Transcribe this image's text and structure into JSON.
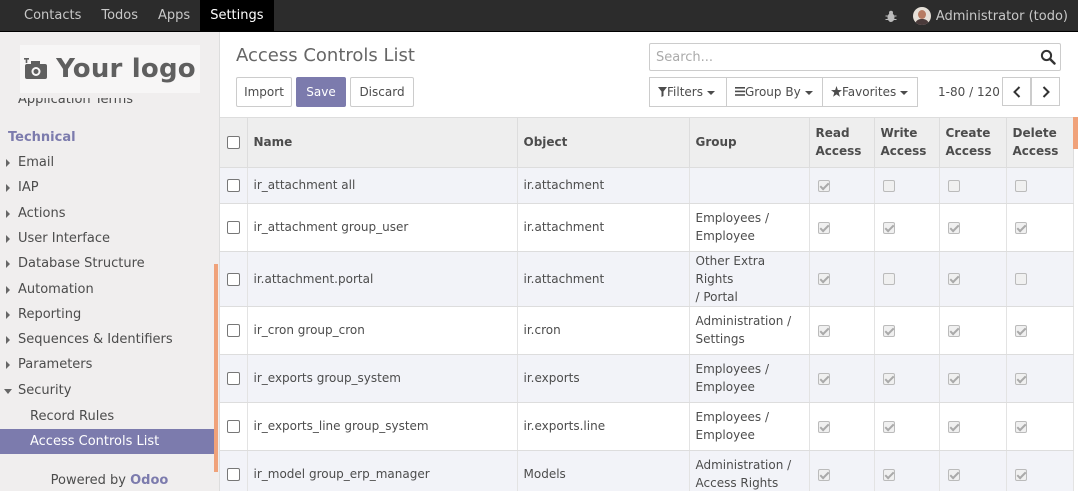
{
  "topbar": {
    "menu": [
      "Contacts",
      "Todos",
      "Apps",
      "Settings"
    ],
    "active_index": 3,
    "user_name": "Administrator (todo)"
  },
  "sidebar": {
    "logo_text": "Your logo",
    "cut_item": "Application Terms",
    "section": "Technical",
    "items": [
      {
        "label": "Email"
      },
      {
        "label": "IAP"
      },
      {
        "label": "Actions"
      },
      {
        "label": "User Interface"
      },
      {
        "label": "Database Structure"
      },
      {
        "label": "Automation"
      },
      {
        "label": "Reporting"
      },
      {
        "label": "Sequences & Identifiers"
      },
      {
        "label": "Parameters"
      },
      {
        "label": "Security"
      },
      {
        "label": "Record Rules"
      },
      {
        "label": "Access Controls List"
      }
    ],
    "powered_by": "Powered by",
    "powered_brand": "Odoo"
  },
  "control_panel": {
    "title": "Access Controls List",
    "import_label": "Import",
    "save_label": "Save",
    "discard_label": "Discard",
    "search_placeholder": "Search...",
    "filters_label": "Filters",
    "group_by_label": "Group By",
    "favorites_label": "Favorites",
    "pager_value": "1-80",
    "pager_sep": "/",
    "pager_total": "120"
  },
  "table": {
    "headers": {
      "name": "Name",
      "object": "Object",
      "group": "Group",
      "read": [
        "Read",
        "Access"
      ],
      "write": [
        "Write",
        "Access"
      ],
      "create": [
        "Create",
        "Access"
      ],
      "delete": [
        "Delete",
        "Access"
      ]
    },
    "rows": [
      {
        "name": "ir_attachment all",
        "object": "ir.attachment",
        "group": [
          "",
          ""
        ],
        "read": true,
        "write": false,
        "create": false,
        "delete": false
      },
      {
        "name": "ir_attachment group_user",
        "object": "ir.attachment",
        "group": [
          "Employees /",
          "Employee"
        ],
        "read": true,
        "write": true,
        "create": true,
        "delete": true
      },
      {
        "name": "ir.attachment.portal",
        "object": "ir.attachment",
        "group": [
          "Other Extra Rights",
          "/ Portal"
        ],
        "read": true,
        "write": false,
        "create": true,
        "delete": false
      },
      {
        "name": "ir_cron group_cron",
        "object": "ir.cron",
        "group": [
          "Administration /",
          "Settings"
        ],
        "read": true,
        "write": true,
        "create": true,
        "delete": true
      },
      {
        "name": "ir_exports group_system",
        "object": "ir.exports",
        "group": [
          "Employees /",
          "Employee"
        ],
        "read": true,
        "write": true,
        "create": true,
        "delete": true
      },
      {
        "name": "ir_exports_line group_system",
        "object": "ir.exports.line",
        "group": [
          "Employees /",
          "Employee"
        ],
        "read": true,
        "write": true,
        "create": true,
        "delete": true
      },
      {
        "name": "ir_model group_erp_manager",
        "object": "Models",
        "group": [
          "Administration /",
          "Access Rights"
        ],
        "read": true,
        "write": true,
        "create": true,
        "delete": true
      }
    ]
  }
}
